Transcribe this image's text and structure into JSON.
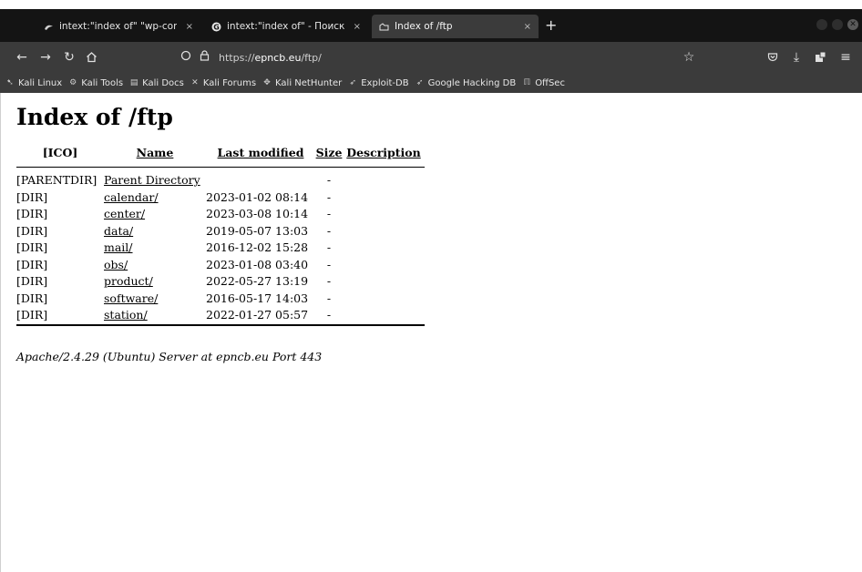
{
  "browser": {
    "tabs": [
      {
        "title": "intext:\"index of\" \"wp-con",
        "close": "×",
        "icon": "kali-icon",
        "active": false
      },
      {
        "title": "intext:\"index of\" - Поиск в",
        "close": "×",
        "icon": "google-icon",
        "active": false
      },
      {
        "title": "Index of /ftp",
        "close": "×",
        "icon": "folder-icon",
        "active": true
      }
    ],
    "new_tab": "+",
    "url": {
      "prefix": "https://",
      "host": "epncb.eu",
      "path": "/ftp/"
    },
    "bookmarks": [
      {
        "label": "Kali Linux",
        "icon": "kali-icon"
      },
      {
        "label": "Kali Tools",
        "icon": "tools-icon"
      },
      {
        "label": "Kali Docs",
        "icon": "docs-icon"
      },
      {
        "label": "Kali Forums",
        "icon": "forums-icon"
      },
      {
        "label": "Kali NetHunter",
        "icon": "nethunter-icon"
      },
      {
        "label": "Exploit-DB",
        "icon": "exploit-icon"
      },
      {
        "label": "Google Hacking DB",
        "icon": "ghdb-icon"
      },
      {
        "label": "OffSec",
        "icon": "offsec-icon"
      }
    ]
  },
  "page": {
    "title": "Index of /ftp",
    "headers": {
      "icon": "[ICO]",
      "name": "Name",
      "modified": "Last modified",
      "size": "Size",
      "description": "Description"
    },
    "rows": [
      {
        "type": "[PARENTDIR]",
        "name": "Parent Directory",
        "modified": "",
        "size": "-"
      },
      {
        "type": "[DIR]",
        "name": "calendar/",
        "modified": "2023-01-02 08:14",
        "size": "-"
      },
      {
        "type": "[DIR]",
        "name": "center/",
        "modified": "2023-03-08 10:14",
        "size": "-"
      },
      {
        "type": "[DIR]",
        "name": "data/",
        "modified": "2019-05-07 13:03",
        "size": "-"
      },
      {
        "type": "[DIR]",
        "name": "mail/",
        "modified": "2016-12-02 15:28",
        "size": "-"
      },
      {
        "type": "[DIR]",
        "name": "obs/",
        "modified": "2023-01-08 03:40",
        "size": "-"
      },
      {
        "type": "[DIR]",
        "name": "product/",
        "modified": "2022-05-27 13:19",
        "size": "-"
      },
      {
        "type": "[DIR]",
        "name": "software/",
        "modified": "2016-05-17 14:03",
        "size": "-"
      },
      {
        "type": "[DIR]",
        "name": "station/",
        "modified": "2022-01-27 05:57",
        "size": "-"
      }
    ],
    "address": "Apache/2.4.29 (Ubuntu) Server at epncb.eu Port 443"
  }
}
